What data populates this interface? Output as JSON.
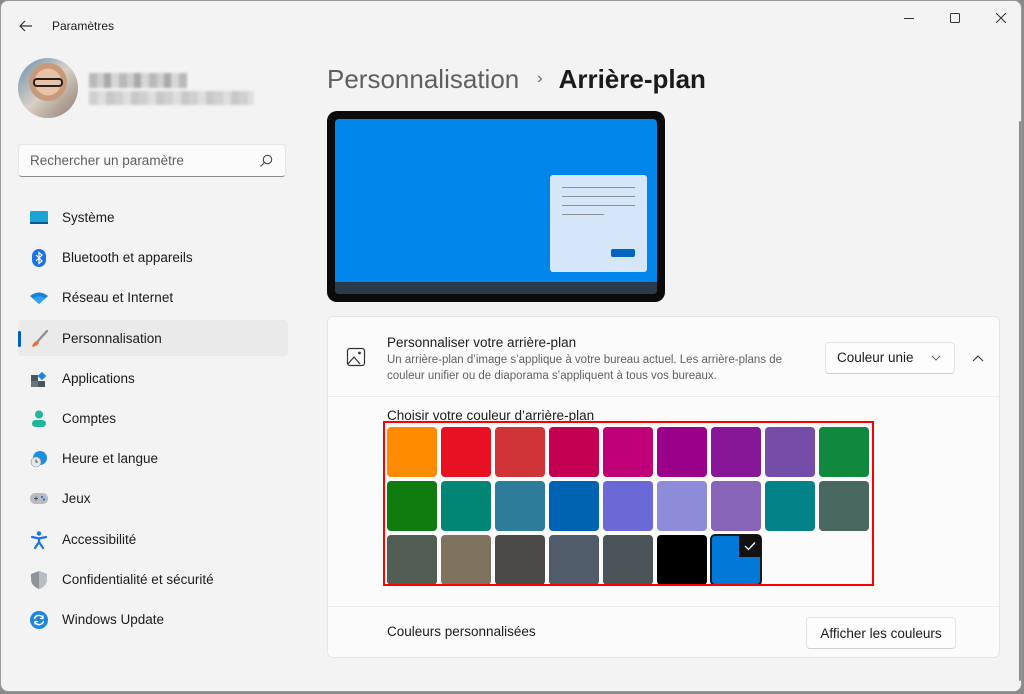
{
  "window": {
    "title": "Paramètres",
    "controls": {
      "minimize": "minimize",
      "maximize": "maximize",
      "close": "close"
    }
  },
  "profile": {
    "name": "(masqué)",
    "email": "(masqué)"
  },
  "search": {
    "placeholder": "Rechercher un paramètre",
    "value": ""
  },
  "sidebar": {
    "active": "Personnalisation",
    "items": [
      {
        "label": "Système",
        "icon": "monitor-icon"
      },
      {
        "label": "Bluetooth et appareils",
        "icon": "bluetooth-icon"
      },
      {
        "label": "Réseau et Internet",
        "icon": "wifi-icon"
      },
      {
        "label": "Personnalisation",
        "icon": "paintbrush-icon"
      },
      {
        "label": "Applications",
        "icon": "apps-icon"
      },
      {
        "label": "Comptes",
        "icon": "person-icon"
      },
      {
        "label": "Heure et langue",
        "icon": "clock-globe-icon"
      },
      {
        "label": "Jeux",
        "icon": "gamepad-icon"
      },
      {
        "label": "Accessibilité",
        "icon": "accessibility-icon"
      },
      {
        "label": "Confidentialité et sécurité",
        "icon": "shield-icon"
      },
      {
        "label": "Windows Update",
        "icon": "update-icon"
      }
    ]
  },
  "breadcrumb": {
    "parent": "Personnalisation",
    "separator": "›",
    "current": "Arrière-plan"
  },
  "preview": {
    "background_color": "#0086ea"
  },
  "background_card": {
    "title": "Personnaliser votre arrière-plan",
    "description": "Un arrière-plan d’image s’applique à votre bureau actuel. Les arrière-plans de couleur unifier ou de diaporama s’appliquent à tous vos bureaux.",
    "dropdown_value": "Couleur unie",
    "expanded": true
  },
  "color_picker": {
    "label": "Choisir votre couleur d’arrière-plan",
    "selected_index": 24,
    "colors": [
      "#ff8c00",
      "#e81123",
      "#d13438",
      "#c30052",
      "#bf0077",
      "#9a0089",
      "#881798",
      "#744da9",
      "#10893e",
      "#107c10",
      "#018574",
      "#2d7d9a",
      "#0063b1",
      "#6b69d6",
      "#8e8cd8",
      "#8764b8",
      "#038387",
      "#486860",
      "#525e54",
      "#7e735f",
      "#4c4a48",
      "#515c6b",
      "#4a5459",
      "#000000",
      "#0078d7"
    ]
  },
  "custom_colors": {
    "label": "Couleurs personnalisées",
    "button_label": "Afficher les couleurs"
  }
}
